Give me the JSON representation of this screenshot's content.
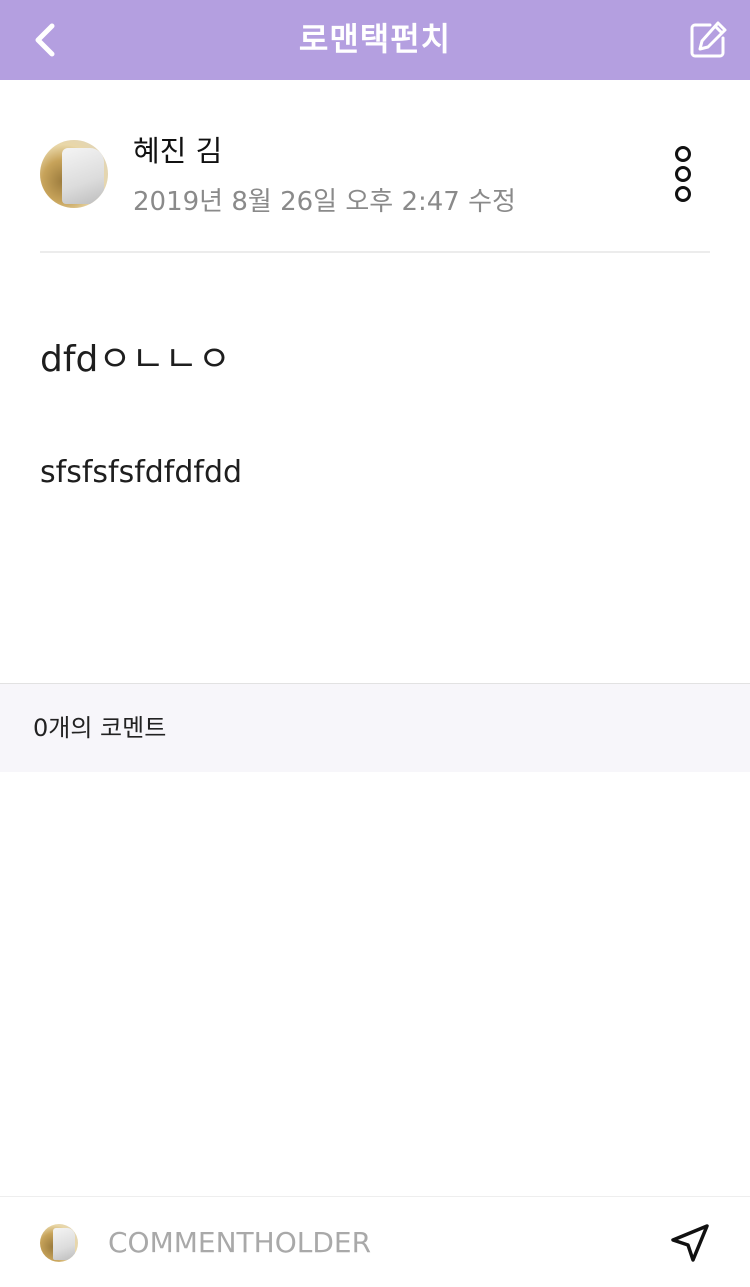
{
  "header": {
    "title": "로맨택펀치",
    "background": "#b49fe0",
    "back_icon": "chevron-left-icon",
    "edit_icon": "edit-icon"
  },
  "post": {
    "author_name": "혜진 김",
    "date": "2019년 8월 26일 오후 2:47 수정",
    "more_icon": "more-vertical-icon",
    "title": "dfdㅇㄴㄴㅇ",
    "body": "sfsfsfsfdfdfdd"
  },
  "comments": {
    "count_label": "0개의 코멘트"
  },
  "comment_input": {
    "placeholder": "COMMENTHOLDER",
    "value": "",
    "send_icon": "send-icon"
  }
}
